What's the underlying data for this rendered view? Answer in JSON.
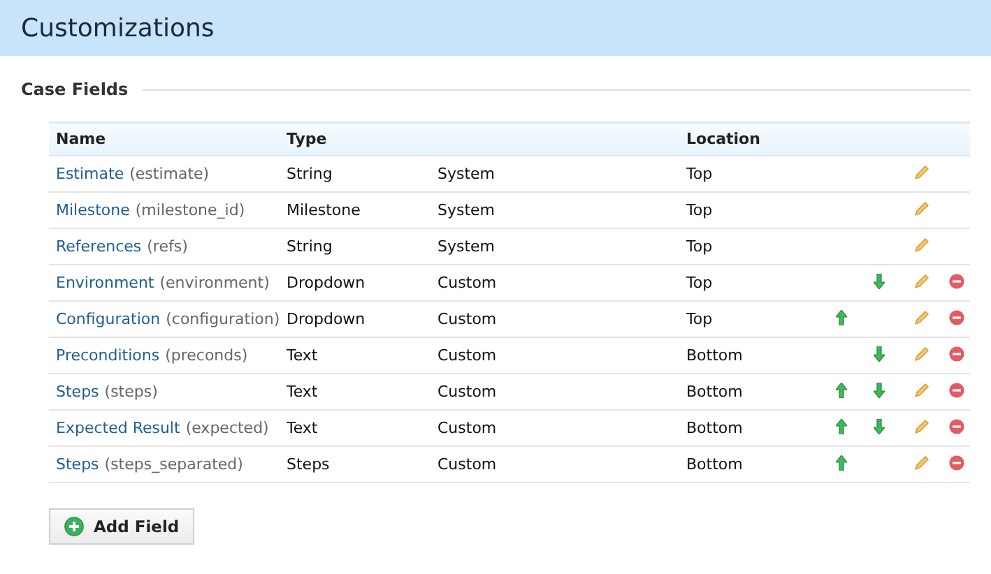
{
  "page_title": "Customizations",
  "section_title": "Case Fields",
  "table": {
    "columns": [
      "Name",
      "Type",
      "",
      "Location"
    ],
    "rows": [
      {
        "name": "Estimate",
        "system_name": "(estimate)",
        "type": "String",
        "origin": "System",
        "location": "Top",
        "move_up": false,
        "move_down": false,
        "deletable": false
      },
      {
        "name": "Milestone",
        "system_name": "(milestone_id)",
        "type": "Milestone",
        "origin": "System",
        "location": "Top",
        "move_up": false,
        "move_down": false,
        "deletable": false
      },
      {
        "name": "References",
        "system_name": "(refs)",
        "type": "String",
        "origin": "System",
        "location": "Top",
        "move_up": false,
        "move_down": false,
        "deletable": false
      },
      {
        "name": "Environment",
        "system_name": "(environment)",
        "type": "Dropdown",
        "origin": "Custom",
        "location": "Top",
        "move_up": false,
        "move_down": true,
        "deletable": true
      },
      {
        "name": "Configuration",
        "system_name": "(configuration)",
        "type": "Dropdown",
        "origin": "Custom",
        "location": "Top",
        "move_up": true,
        "move_down": false,
        "deletable": true
      },
      {
        "name": "Preconditions",
        "system_name": "(preconds)",
        "type": "Text",
        "origin": "Custom",
        "location": "Bottom",
        "move_up": false,
        "move_down": true,
        "deletable": true
      },
      {
        "name": "Steps",
        "system_name": "(steps)",
        "type": "Text",
        "origin": "Custom",
        "location": "Bottom",
        "move_up": true,
        "move_down": true,
        "deletable": true
      },
      {
        "name": "Expected Result",
        "system_name": "(expected)",
        "type": "Text",
        "origin": "Custom",
        "location": "Bottom",
        "move_up": true,
        "move_down": true,
        "deletable": true
      },
      {
        "name": "Steps",
        "system_name": "(steps_separated)",
        "type": "Steps",
        "origin": "Custom",
        "location": "Bottom",
        "move_up": true,
        "move_down": false,
        "deletable": true
      }
    ]
  },
  "add_button": "Add Field"
}
